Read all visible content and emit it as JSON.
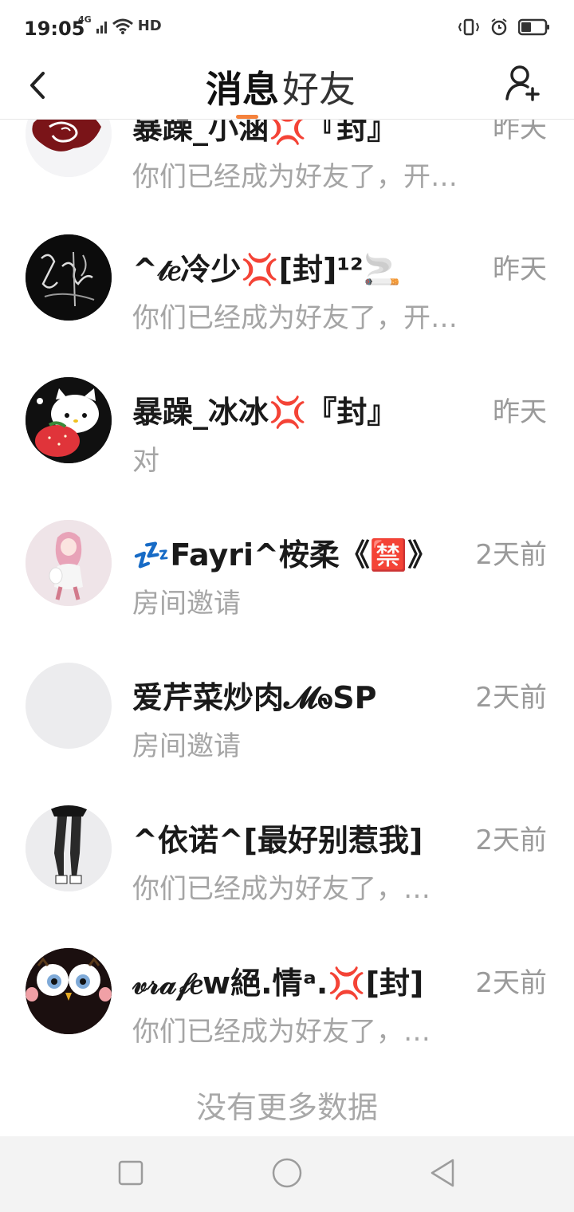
{
  "status_bar": {
    "time": "19:05",
    "network": "4G",
    "hd": "HD"
  },
  "header": {
    "tabs": [
      {
        "label": "消息",
        "active": true
      },
      {
        "label": "好友",
        "active": false
      }
    ],
    "accent_color": "#f5823c"
  },
  "conversations": [
    {
      "name": "暴躁_小涵💢『封』",
      "preview": "你们已经成为好友了，开始聊天吧",
      "time": "昨天",
      "avatar": "rose-avatar"
    },
    {
      "name": "^𝓉𝑒冷少💢[封]¹²🚬",
      "preview": "你们已经成为好友了，开始聊天吧",
      "time": "昨天",
      "avatar": "dark-sketch-avatar"
    },
    {
      "name": "暴躁_冰冰💢『封』",
      "preview": "对",
      "time": "昨天",
      "avatar": "hello-kitty-avatar"
    },
    {
      "name": "💤Fayri^桉柔《🈲》",
      "preview": "房间邀请",
      "time": "2天前",
      "avatar": "anime-girl-avatar"
    },
    {
      "name": "爱芹菜炒肉𝓜ꮻSP",
      "preview": "房间邀请",
      "time": "2天前",
      "avatar": "blank-avatar"
    },
    {
      "name": "^依诺^[最好别惹我]",
      "preview": "你们已经成为好友了，开始聊天吧",
      "time": "2天前",
      "avatar": "legs-avatar"
    },
    {
      "name": "𝓋𝓇𝒶𝒻𝑒w絕.情ᵃ.💢[封]",
      "preview": "你们已经成为好友了，开始聊天吧",
      "time": "2天前",
      "avatar": "owl-avatar"
    }
  ],
  "footer_text": "没有更多数据"
}
